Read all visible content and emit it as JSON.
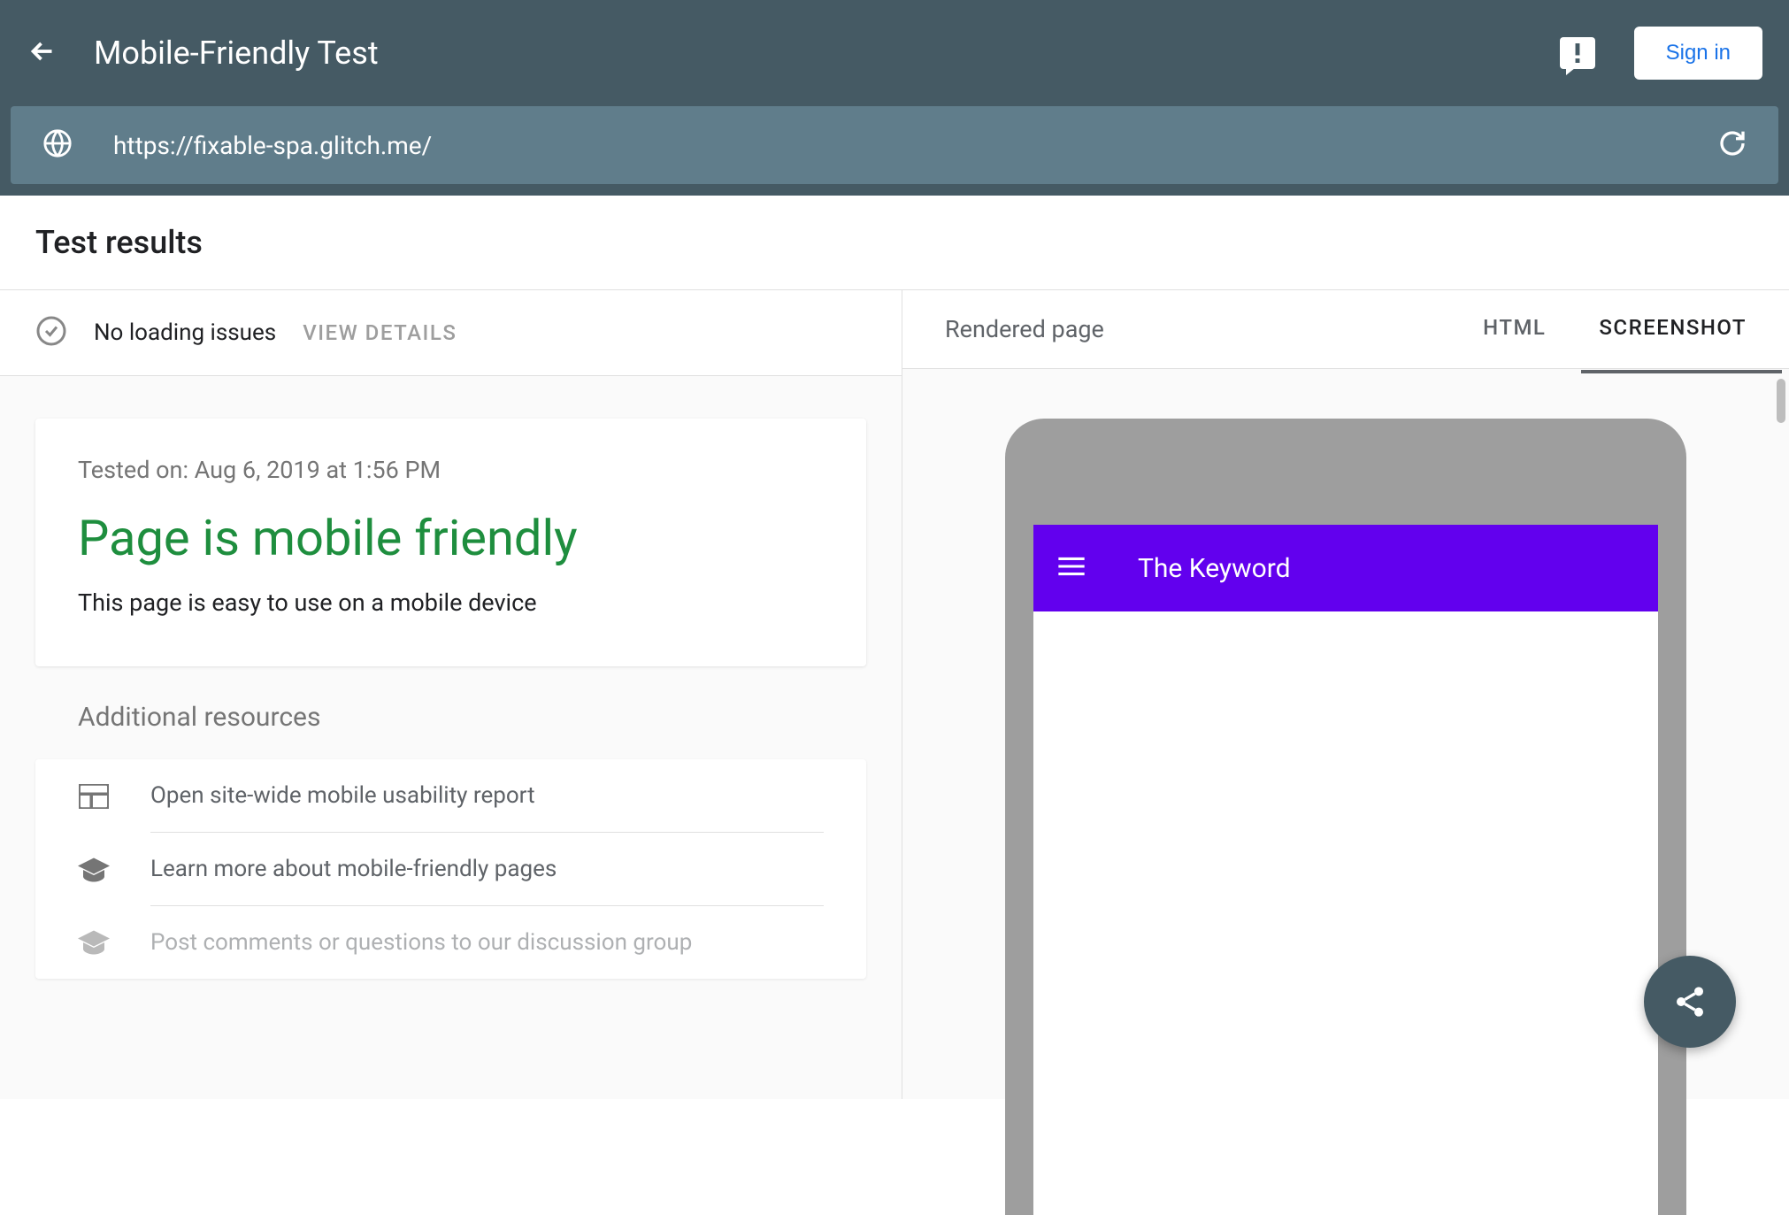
{
  "header": {
    "title": "Mobile-Friendly Test",
    "signin": "Sign in"
  },
  "url_bar": {
    "url": "https://fixable-spa.glitch.me/"
  },
  "results": {
    "section_title": "Test results",
    "loading_status": "No loading issues",
    "view_details": "VIEW DETAILS",
    "tested_on": "Tested on: Aug 6, 2019 at 1:56 PM",
    "verdict": "Page is mobile friendly",
    "verdict_sub": "This page is easy to use on a mobile device"
  },
  "additional": {
    "title": "Additional resources",
    "items": [
      "Open site-wide mobile usability report",
      "Learn more about mobile-friendly pages",
      "Post comments or questions to our discussion group"
    ]
  },
  "right": {
    "rendered_label": "Rendered page",
    "tabs": {
      "html": "HTML",
      "screenshot": "SCREENSHOT"
    }
  },
  "phone": {
    "app_title": "The Keyword"
  }
}
